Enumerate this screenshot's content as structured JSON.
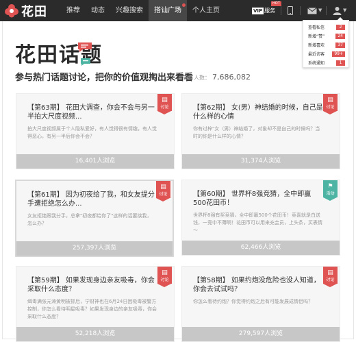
{
  "app": {
    "logo_text": "花田"
  },
  "nav": [
    {
      "label": "推荐",
      "active": false
    },
    {
      "label": "动态",
      "active": false
    },
    {
      "label": "兴趣搜索",
      "active": false
    },
    {
      "label": "搭讪广场",
      "active": true
    },
    {
      "label": "个人主页",
      "active": false
    }
  ],
  "toolbar": {
    "vip_box": "VIP",
    "vip_label": "服务",
    "hot_badge": "HOT",
    "phone_icon": "phone-icon",
    "mail_icon": "mail-icon",
    "user_icon": "user-icon"
  },
  "dropdown": [
    {
      "label": "查看私信",
      "count": "2"
    },
    {
      "label": "新增“赞”",
      "count": "24"
    },
    {
      "label": "新增喜欢",
      "count": "37"
    },
    {
      "label": "最近访客",
      "count": "99+"
    },
    {
      "label": "系统通知",
      "count": "1"
    }
  ],
  "page": {
    "title": "花田话题",
    "subtitle": "参与热门话题讨论，把你的价值观掏出来看看",
    "people_label": "参与人数：",
    "people_count": "7,686,082"
  },
  "cards": [
    {
      "title": "【第63期】 花田大调查，你会不会与另一半拍大尺度视频...",
      "desc": "拍大尺度视频属于个人隐私爱好，有人觉得很有情趣，有人觉得恶心，有另一半后你会不会？",
      "views": "16,401人浏览",
      "tag": "讨论",
      "tag_color": "#e05353"
    },
    {
      "title": "【第62期】 女(男）神结婚的时候，自己是什么样的心情",
      "desc": "你有过梓\"女（男）神结婚了，对象却不是自己的时候吗？当时的你是什么样的心情？",
      "views": "31,374人浏览",
      "tag": "讨论",
      "tag_color": "#e05353"
    },
    {
      "title": "【第61期】 因为初夜给了我，和女友提分手遭拒绝怎么办...",
      "desc": "女友拒绝跟我分手，总拿\"初夜都给你了\"这样的话要挟我，怎么办？",
      "views": "257,397人浏览",
      "tag": "讨论",
      "tag_color": "#e05353"
    },
    {
      "title": "【第60期】 世界杯8强竞猜，全中即赢500花田币！",
      "desc": "世界杯8强有奖竞猜，全中即赢500个花田币！竞喜就是白送钱，一竞中不薄啊！花田币可以用来充会员，上头条，买表情～",
      "views": "62,466人浏览",
      "tag": "活动",
      "tag_color": "#4db3a3"
    },
    {
      "title": "【第59期】 如果发现身边亲友吸毒，你会采取什么态度？",
      "desc": "缉毒满张元涛黄明被抓后，宁财神也在6月24日因吸毒被警方控制，你怎么看待明星吸毒？如果发现身边的亲友吸毒，你会采取什么态度？",
      "views": "52,218人浏览",
      "tag": "讨论",
      "tag_color": "#e05353"
    },
    {
      "title": "【第58期】 如果约炮没危险也没人知道，你会去试试吗？",
      "desc": "你怎么看待约炮？你觉得约炮之后有可能发展成情侣吗？",
      "views": "279,597人浏览",
      "tag": "讨论",
      "tag_color": "#e05353"
    }
  ]
}
